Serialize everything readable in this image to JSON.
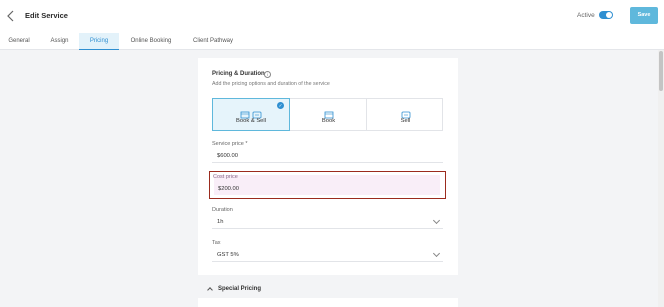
{
  "header": {
    "back_icon": "chevron-left-icon",
    "title": "Edit Service",
    "active_label": "Active",
    "active_on": true,
    "save_label": "Save",
    "accent_color": "#5fb8dc"
  },
  "tabs": [
    {
      "label": "General",
      "active": false
    },
    {
      "label": "Assign",
      "active": false
    },
    {
      "label": "Pricing",
      "active": true
    },
    {
      "label": "Online Booking",
      "active": false
    },
    {
      "label": "Client Pathway",
      "active": false
    }
  ],
  "pricing": {
    "title": "Pricing & Duration",
    "info_icon": "info-icon",
    "subtitle": "Add the pricing options and duration of the service",
    "types": [
      {
        "label": "Book & Sell",
        "icon": "calendar-cart-icon",
        "selected": true
      },
      {
        "label": "Book",
        "icon": "calendar-icon",
        "selected": false
      },
      {
        "label": "Sell",
        "icon": "cart-icon",
        "selected": false
      }
    ],
    "service_price": {
      "label": "Service price *",
      "value": "$600.00"
    },
    "cost_price": {
      "label": "Cost price",
      "value": "$200.00"
    },
    "duration": {
      "label": "Duration",
      "value": "1h"
    },
    "tax": {
      "label": "Tax",
      "value": "GST 5%"
    }
  },
  "special_pricing": {
    "label": "Special Pricing",
    "expanded": true
  },
  "colors": {
    "highlight_border": "#9b2b1e",
    "tab_active": "#2f8fd1"
  }
}
